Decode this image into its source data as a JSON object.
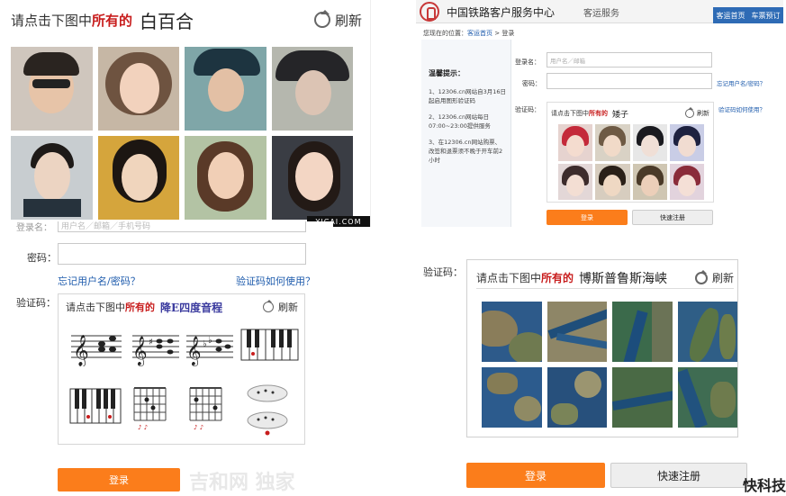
{
  "panel_faces": {
    "prompt_prefix": "请点击下图中",
    "prompt_highlight": "所有的",
    "target": "白百合",
    "refresh": "刷新",
    "watermark": "YICAI.COM",
    "image_count": 8
  },
  "panel_12306": {
    "site_title": "中国铁路客户服务中心",
    "site_subtitle": "客运服务",
    "nav": [
      "客运首页",
      "车票预订"
    ],
    "breadcrumb_prefix": "您现在的位置：",
    "breadcrumb_home": "客运首页",
    "breadcrumb_sep": " > ",
    "breadcrumb_current": "登录",
    "tips_title": "温馨提示：",
    "tips": [
      "1、12306.cn网站自3月16日起启用图形验证码",
      "2、12306.cn网站每日07:00~23:00提供服务",
      "3、在12306.cn网站购票、改签和退票须不晚于开车前2小时"
    ],
    "username_label": "登录名：",
    "username_placeholder": "用户名／邮箱",
    "password_label": "密码：",
    "forgot_link": "忘记用户名/密码？",
    "captcha_label": "验证码：",
    "captcha_help_link": "验证码如何使用？",
    "prompt_prefix": "请点击下图中",
    "prompt_highlight": "所有的",
    "target": "矮子",
    "refresh": "刷新",
    "login_button": "登录",
    "register_button": "快速注册"
  },
  "panel_music": {
    "username_label": "登录名：",
    "username_placeholder": "用户名／邮箱／手机号码",
    "password_label": "密码：",
    "forgot_link": "忘记用户名/密码？",
    "captcha_help_link": "验证码如何使用？",
    "captcha_label": "验证码：",
    "prompt_prefix": "请点击下图中",
    "prompt_highlight": "所有的",
    "target": "降E四度音程",
    "refresh": "刷新",
    "login_button": "登录",
    "overlay_text": "吉和网 独家"
  },
  "panel_satellite": {
    "captcha_label": "验证码：",
    "prompt_prefix": "请点击下图中",
    "prompt_highlight": "所有的",
    "target": "博斯普鲁斯海峡",
    "refresh": "刷新",
    "login_button": "登录",
    "register_button": "快速注册",
    "logo_text": "快科技"
  },
  "colors": {
    "highlight_red": "#c81d1d",
    "login_orange": "#fb7d1b",
    "link_blue": "#1f5cad",
    "nav_blue": "#2e6bb5"
  }
}
